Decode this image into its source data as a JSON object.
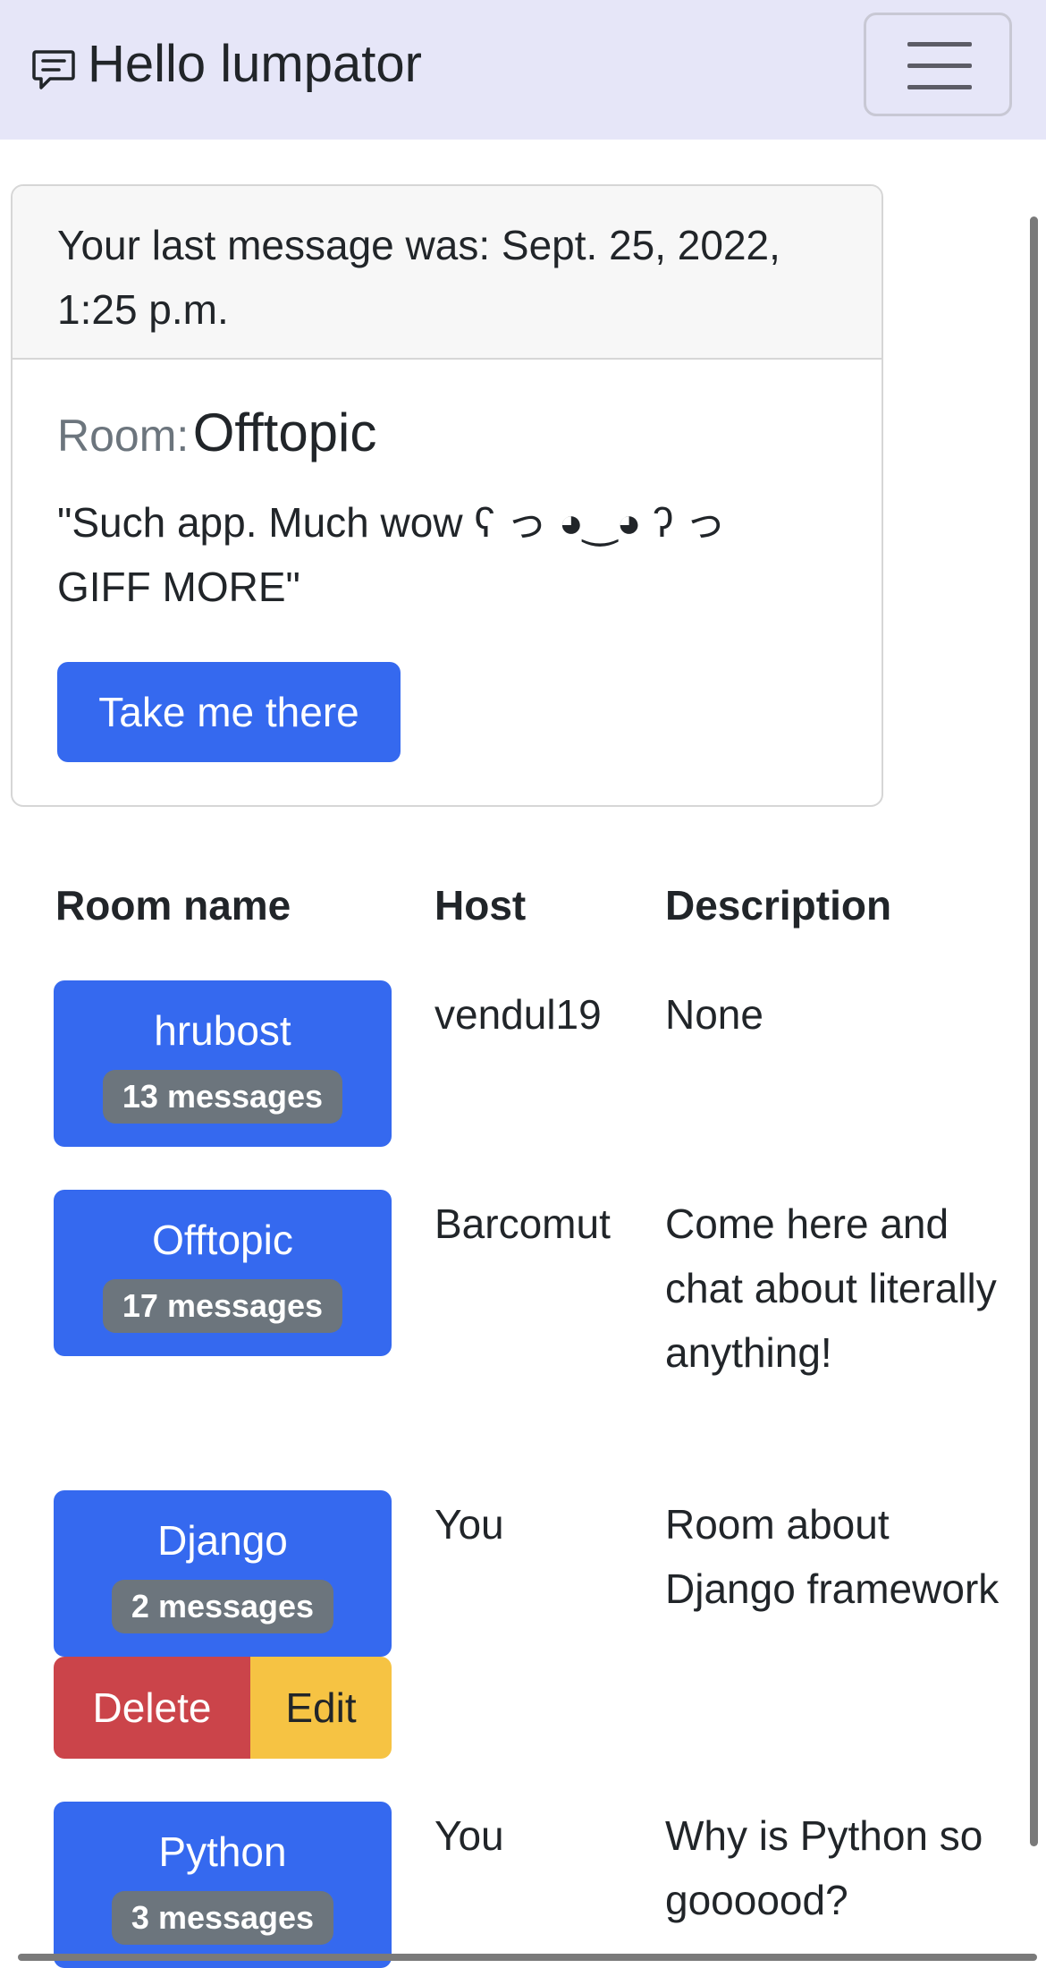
{
  "navbar": {
    "brand_text": "Hello lumpator",
    "brand_icon": "chat-icon",
    "menu_icon": "hamburger-menu-icon"
  },
  "last_message": {
    "header": "Your last message was: Sept. 25, 2022, 1:25 p.m.",
    "room_label": "Room:",
    "room_name": "Offtopic",
    "quote": "\"Such app. Much wow ʕ⁠ っ ◕‿◕ ʔ っ GIFF MORE\"",
    "button_label": "Take me there"
  },
  "table": {
    "headers": {
      "room_name": "Room name",
      "host": "Host",
      "description": "Description"
    },
    "rows": [
      {
        "room": "hrubost",
        "messages": "13 messages",
        "host": "vendul19",
        "description": "None"
      },
      {
        "room": "Offtopic",
        "messages": "17 messages",
        "host": "Barcomut",
        "description": "Come here and chat about literally anything!"
      },
      {
        "room": "Django",
        "messages": "2 messages",
        "host": "You",
        "description": "Room about Django framework",
        "delete_label": "Delete",
        "edit_label": "Edit"
      },
      {
        "room": "Python",
        "messages": "3 messages",
        "host": "You",
        "description": "Why is Python so goooood?"
      }
    ]
  },
  "colors": {
    "navbar_bg": "#e6e6f8",
    "primary": "#3569ef",
    "secondary_badge": "#6c757d",
    "danger": "#cb444a",
    "warning": "#f6c343"
  }
}
